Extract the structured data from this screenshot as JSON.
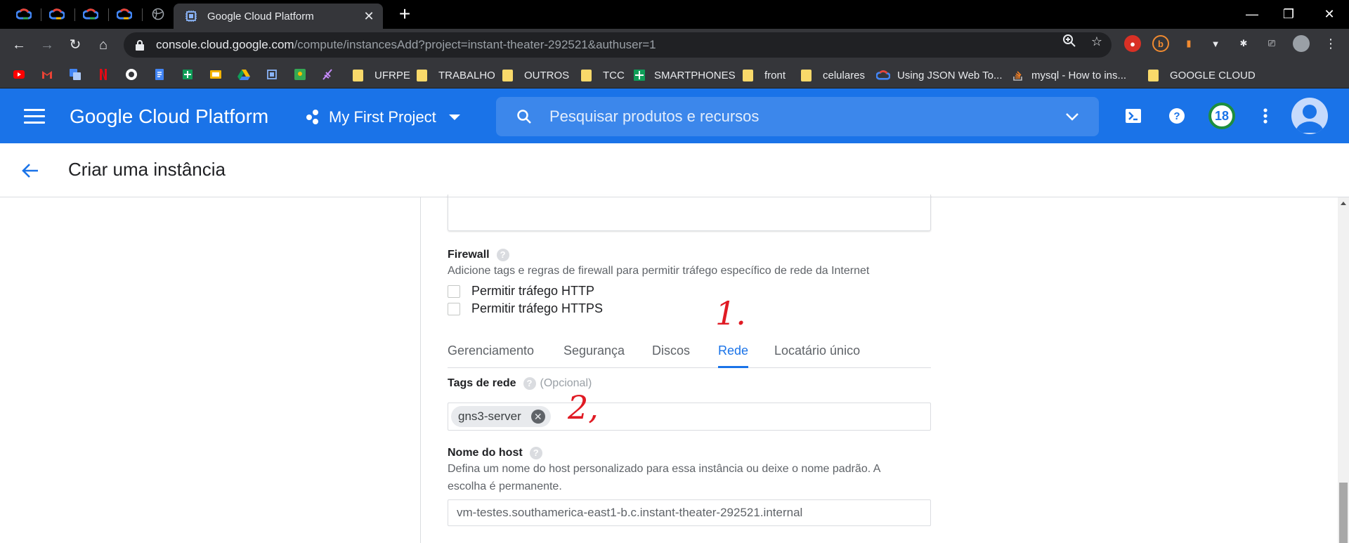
{
  "browser": {
    "active_tab_title": "Google Cloud Platform",
    "url_host": "console.cloud.google.com",
    "url_path": "/compute/instancesAdd?project=instant-theater-292521&authuser=1",
    "bookmarks": [
      "UFRPE",
      "TRABALHO",
      "OUTROS",
      "TCC",
      "SMARTPHONES",
      "front",
      "celulares",
      "Using JSON Web To...",
      "mysql - How to ins...",
      "GOOGLE CLOUD"
    ]
  },
  "header": {
    "title": "Google Cloud Platform",
    "project": "My First Project",
    "search_placeholder": "Pesquisar produtos e recursos",
    "notifications": "18"
  },
  "page": {
    "title": "Criar uma instância"
  },
  "firewall": {
    "label": "Firewall",
    "description": "Adicione tags e regras de firewall para permitir tráfego específico de rede da Internet",
    "http": "Permitir tráfego HTTP",
    "https": "Permitir tráfego HTTPS"
  },
  "tabs": [
    "Gerenciamento",
    "Segurança",
    "Discos",
    "Rede",
    "Locatário único"
  ],
  "active_tab": "Rede",
  "network_tags": {
    "label": "Tags de rede",
    "optional": "(Opcional)",
    "chips": [
      "gns3-server"
    ]
  },
  "hostname": {
    "label": "Nome do host",
    "description_line1": "Defina um nome do host personalizado para essa instância ou deixe o nome padrão. A",
    "description_line2": "escolha é permanente.",
    "value": "vm-testes.southamerica-east1-b.c.instant-theater-292521.internal"
  },
  "annotations": {
    "one": "1.",
    "two": "2,"
  },
  "colors": {
    "primary": "#1a73e8",
    "annotation": "#e01b24"
  }
}
